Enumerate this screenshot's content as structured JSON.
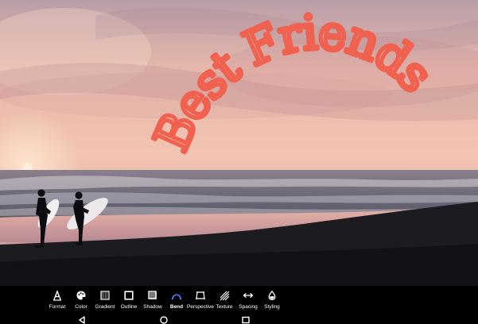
{
  "curved_text": {
    "content": "Best Friends",
    "color": "#f0624f"
  },
  "toolbar": {
    "items": [
      {
        "label": "Format",
        "icon": "format-text-icon",
        "active": false
      },
      {
        "label": "Color",
        "icon": "palette-icon",
        "active": false
      },
      {
        "label": "Gradient",
        "icon": "gradient-icon",
        "active": false
      },
      {
        "label": "Outline",
        "icon": "outline-square-icon",
        "active": false
      },
      {
        "label": "Shadow",
        "icon": "shadow-square-icon",
        "active": false
      },
      {
        "label": "Bend",
        "icon": "bend-arc-icon",
        "active": true
      },
      {
        "label": "Perspective",
        "icon": "perspective-icon",
        "active": false
      },
      {
        "label": "Texture",
        "icon": "texture-icon",
        "active": false
      },
      {
        "label": "Spacing",
        "icon": "spacing-arrows-icon",
        "active": false
      },
      {
        "label": "Styling",
        "icon": "styling-drop-icon",
        "active": false
      }
    ],
    "active_color": "#4f7cff"
  },
  "navigation": {
    "back": "back-icon",
    "home": "home-icon",
    "recents": "recents-icon"
  }
}
